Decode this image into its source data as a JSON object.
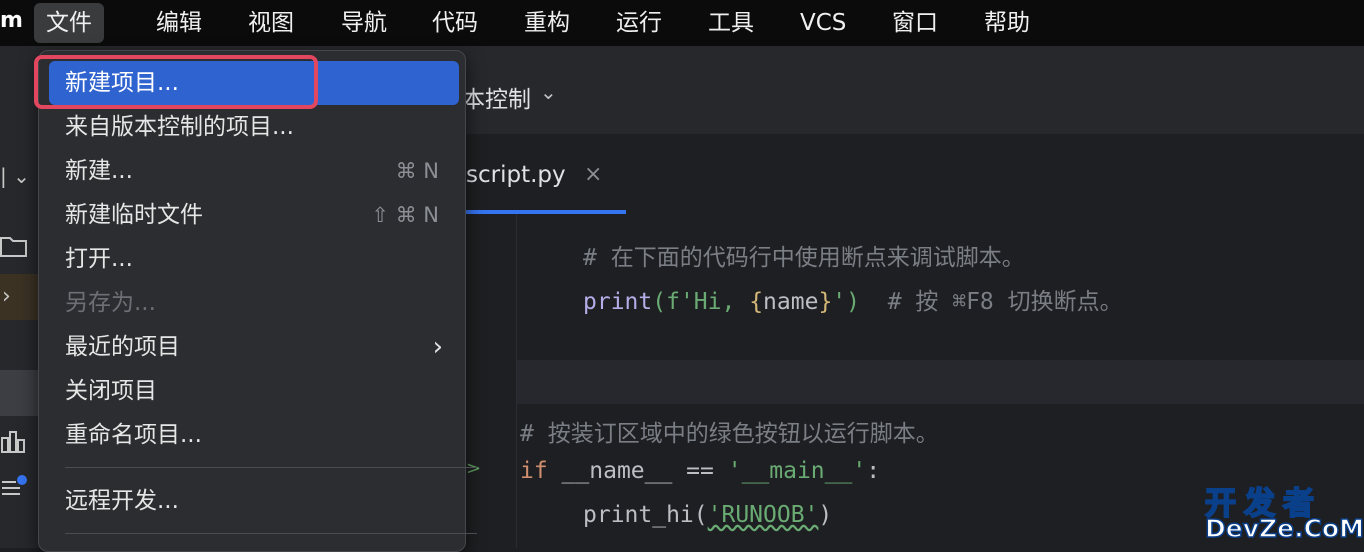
{
  "menubar": {
    "app_fragment": "m",
    "items": [
      "文件",
      "编辑",
      "视图",
      "导航",
      "代码",
      "重构",
      "运行",
      "工具",
      "VCS",
      "窗口",
      "帮助"
    ]
  },
  "toolbar": {
    "vcs_label": "本控制"
  },
  "tab": {
    "filename": "script.py",
    "close_glyph": "×"
  },
  "file_menu": {
    "items": [
      {
        "label": "新建项目...",
        "shortcut": "",
        "state": "selected"
      },
      {
        "label": "来自版本控制的项目...",
        "shortcut": "",
        "state": "normal"
      },
      {
        "label": "新建...",
        "shortcut": "⌘ N",
        "state": "normal"
      },
      {
        "label": "新建临时文件",
        "shortcut": "⇧ ⌘ N",
        "state": "normal"
      },
      {
        "label": "打开...",
        "shortcut": "",
        "state": "normal"
      },
      {
        "label": "另存为...",
        "shortcut": "",
        "state": "disabled"
      },
      {
        "label": "最近的项目",
        "shortcut": "",
        "state": "submenu"
      },
      {
        "label": "关闭项目",
        "shortcut": "",
        "state": "normal"
      },
      {
        "label": "重命名项目...",
        "shortcut": "",
        "state": "normal"
      },
      {
        "label": "远程开发...",
        "shortcut": "",
        "state": "normal"
      }
    ],
    "highlight_color": "#e2475f"
  },
  "code": {
    "comment1": "# 在下面的代码行中使用断点来调试脚本。",
    "print_fn": "print",
    "print_str_open": "(f'Hi, ",
    "print_brace_open": "{",
    "print_var": "name",
    "print_brace_close": "}",
    "print_str_close": "')",
    "print_comment": "  # 按 ⌘F8 切换断点。",
    "comment2": "# 按装订区域中的绿色按钮以运行脚本。",
    "if_kw": "if",
    "if_cond": " __name__ == ",
    "if_str": "'__main__'",
    "if_colon": ":",
    "call_fn": "print_hi(",
    "call_arg": "'RUNOOB'",
    "call_close": ")"
  },
  "watermark": {
    "top": "开发者",
    "bottom": "DevZe.CoM"
  },
  "icons": [
    "folder-icon",
    "chevron-right-icon",
    "chevron-down-icon",
    "structure-icon",
    "todo-icon",
    "run-gutter-icon"
  ]
}
